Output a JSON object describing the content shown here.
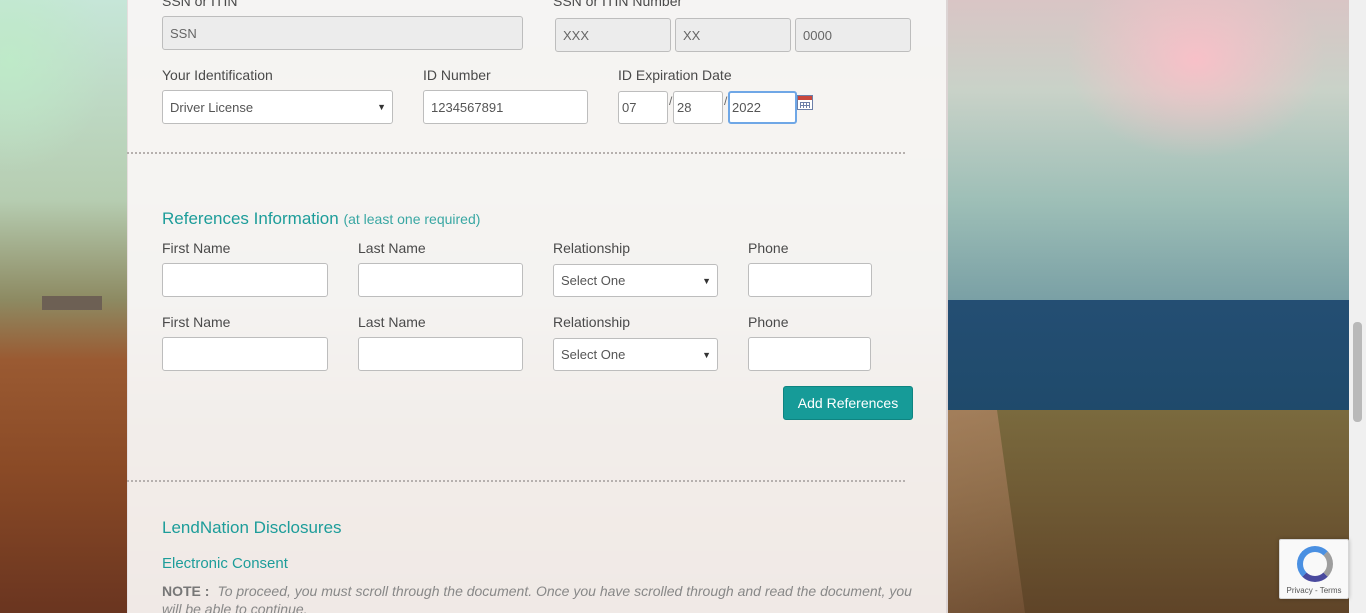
{
  "identity": {
    "ssn_label": "SSN or ITIN",
    "ssn_value": "SSN",
    "ssn_number_label": "SSN or ITIN Number",
    "ssn_parts": [
      "XXX",
      "XX",
      "0000"
    ],
    "id_type_label": "Your Identification",
    "id_type_value": "Driver License",
    "id_number_label": "ID Number",
    "id_number_value": "1234567891",
    "id_exp_label": "ID Expiration Date",
    "id_exp_month": "07",
    "id_exp_day": "28",
    "id_exp_year": "2022",
    "date_separator": "/"
  },
  "references": {
    "title": "References Information",
    "subtitle": "(at least one required)",
    "rows": [
      {
        "first_label": "First Name",
        "last_label": "Last Name",
        "relationship_label": "Relationship",
        "relationship_value": "Select One",
        "phone_label": "Phone"
      },
      {
        "first_label": "First Name",
        "last_label": "Last Name",
        "relationship_label": "Relationship",
        "relationship_value": "Select One",
        "phone_label": "Phone"
      }
    ],
    "add_button": "Add References"
  },
  "disclosures": {
    "title": "LendNation Disclosures",
    "electronic_consent": "Electronic Consent",
    "note_label": "NOTE :",
    "note_text": "To proceed, you must scroll through the document. Once you have scrolled through and read the document, you will be able to continue."
  },
  "recaptcha": {
    "links": "Privacy - Terms"
  },
  "colors": {
    "accent": "#169b98",
    "section_title": "#1d9d9a"
  }
}
